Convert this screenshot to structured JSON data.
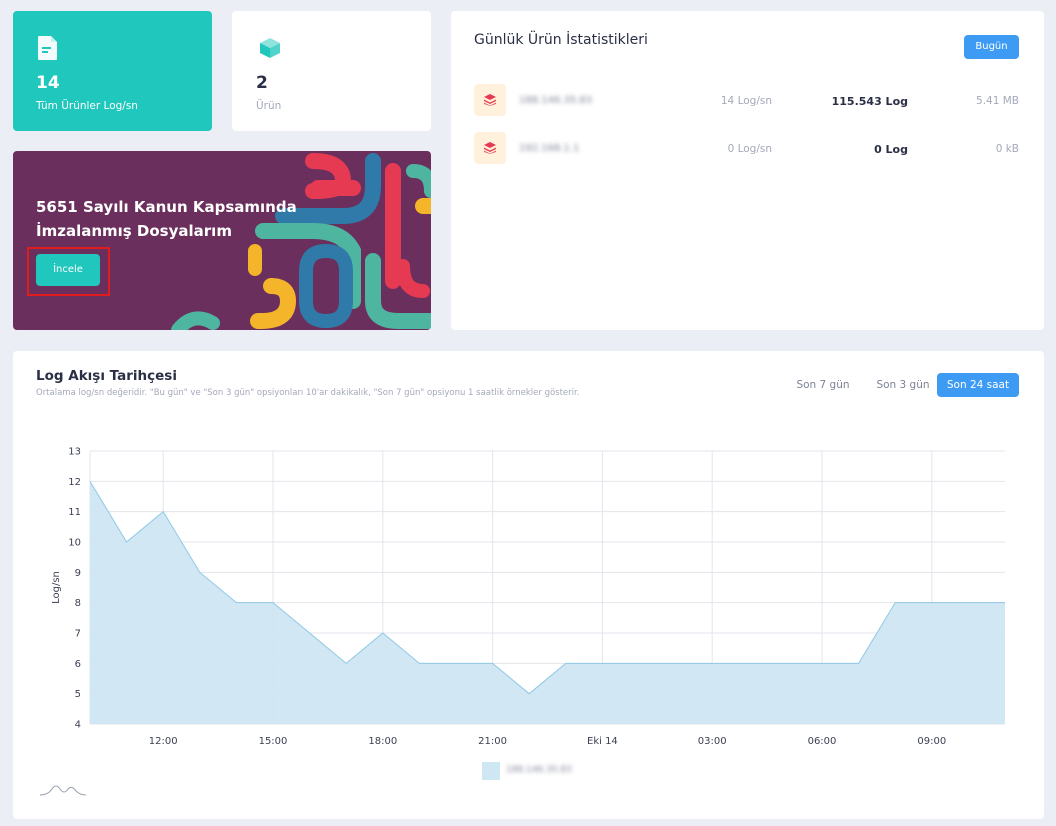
{
  "stats": [
    {
      "value": "14",
      "label": "Tüm Ürünler Log/sn",
      "icon": "document-icon"
    },
    {
      "value": "2",
      "label": "Ürün",
      "icon": "cube-icon"
    }
  ],
  "banner": {
    "title": "5651 Sayılı Kanun Kapsamında İmzalanmış Dosyalarım",
    "button": "İncele"
  },
  "daily": {
    "title": "Günlük Ürün İstatistikleri",
    "today_button": "Bugün",
    "rows": [
      {
        "ip": "188.146.35.83",
        "rate": "14 Log/sn",
        "logs": "115.543 Log",
        "size": "5.41 MB",
        "icon": "layers-icon"
      },
      {
        "ip": "192.168.1.1",
        "rate": "0 Log/sn",
        "logs": "0 Log",
        "size": "0 kB",
        "icon": "layers-icon"
      }
    ]
  },
  "history": {
    "title": "Log Akışı Tarihçesi",
    "subtitle": "Ortalama log/sn değeridir. \"Bu gün\" ve \"Son 3 gün\" opsiyonları 10'ar dakikalık, \"Son 7 gün\" opsiyonu 1 saatlik örnekler gösterir.",
    "ranges": [
      "Son 7 gün",
      "Son 3 gün",
      "Son 24 saat"
    ],
    "active_range": "Son 24 saat"
  },
  "chart_data": {
    "type": "area",
    "ylabel": "Log/sn",
    "xlabel": "",
    "ylim": [
      4,
      13
    ],
    "yticks": [
      4,
      5,
      6,
      7,
      8,
      9,
      10,
      11,
      12,
      13
    ],
    "xtick_labels": [
      "12:00",
      "15:00",
      "18:00",
      "21:00",
      "Eki 14",
      "03:00",
      "06:00",
      "09:00"
    ],
    "x_hours": [
      10,
      11,
      12,
      13,
      14,
      15,
      16,
      17,
      18,
      19,
      20,
      21,
      22,
      23,
      24,
      25,
      26,
      27,
      28,
      29,
      30,
      31,
      32,
      33,
      34
    ],
    "xlim_hours": [
      10,
      35
    ],
    "series": [
      {
        "name": "188.146.35.83",
        "color": "#cfe6f3",
        "line_color": "#8ec8e6",
        "values": [
          12,
          10,
          11,
          9,
          8,
          8,
          7,
          6,
          7,
          6,
          6,
          6,
          5,
          6,
          6,
          6,
          6,
          6,
          6,
          6,
          6,
          6,
          8,
          8,
          8,
          8
        ]
      }
    ],
    "grid": true
  }
}
